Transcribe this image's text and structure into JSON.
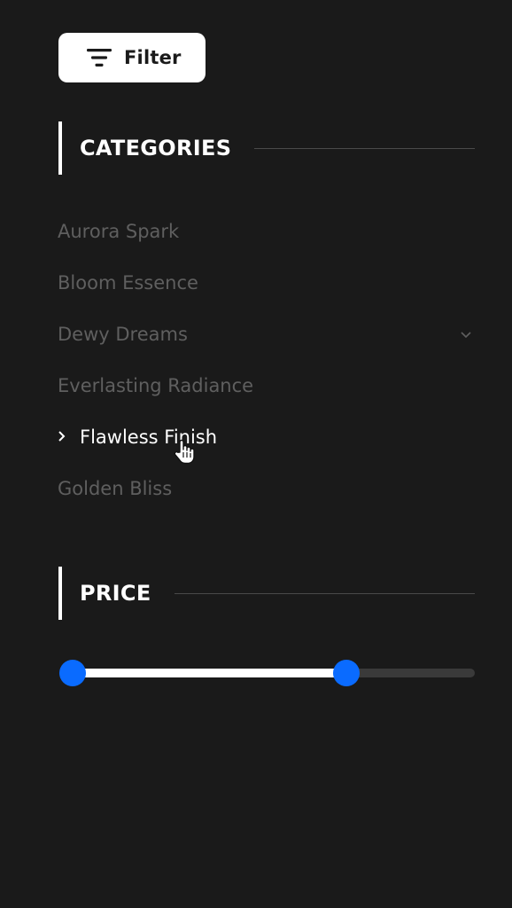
{
  "filter_button": {
    "label": "Filter",
    "icon": "filter-lines-icon"
  },
  "categories": {
    "title": "CATEGORIES",
    "items": [
      {
        "label": "Aurora Spark",
        "active": false,
        "expandable": false
      },
      {
        "label": "Bloom Essence",
        "active": false,
        "expandable": false
      },
      {
        "label": "Dewy Dreams",
        "active": false,
        "expandable": true
      },
      {
        "label": "Everlasting Radiance",
        "active": false,
        "expandable": false
      },
      {
        "label": "Flawless Finish",
        "active": true,
        "expandable": false
      },
      {
        "label": "Golden Bliss",
        "active": false,
        "expandable": false
      }
    ]
  },
  "price": {
    "title": "PRICE",
    "range_min_fraction": 0.0,
    "range_max_fraction": 0.68
  },
  "colors": {
    "background": "#1a1a1a",
    "accent": "#0a6bff",
    "inactive_text": "#5f5f5f",
    "active_text": "#ffffff"
  }
}
